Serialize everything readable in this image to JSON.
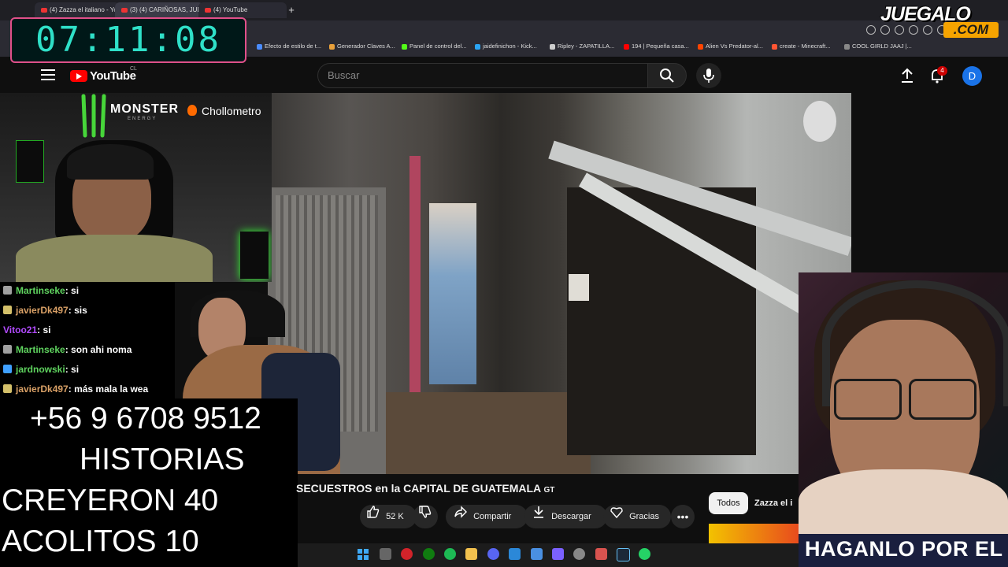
{
  "browser": {
    "tabs": [
      {
        "label": "(4) Zazza el italiano - YouT"
      },
      {
        "label": "(3) (4) CARIÑOSAS, JUD..."
      },
      {
        "label": "(4) YouTube"
      }
    ],
    "bookmarks": [
      {
        "label": "Efecto de estilo de t...",
        "color": "#4a8cff"
      },
      {
        "label": "Generador Claves A...",
        "color": "#e8a03a"
      },
      {
        "label": "Panel de control del...",
        "color": "#53fc18"
      },
      {
        "label": "jaidefinichon - Kick...",
        "color": "#2aa4f4"
      },
      {
        "label": "Ripley - ZAPATILLA...",
        "color": "#cccccc"
      },
      {
        "label": "194 | Pequeña casa...",
        "color": "#ff0000"
      },
      {
        "label": "Alien Vs Predator-al...",
        "color": "#ff4400"
      },
      {
        "label": "create - Minecraft...",
        "color": "#ff5533"
      },
      {
        "label": "COOL GIRLD JAAJ |...",
        "color": "#888888"
      }
    ]
  },
  "timer": {
    "value": "07:11:08"
  },
  "watermark": {
    "line1": "JUEGALO",
    "line2": ".COM"
  },
  "youtube": {
    "logo": "YouTube",
    "country": "CL",
    "search_placeholder": "Buscar",
    "notifications": "4",
    "avatar_letter": "D",
    "video_title": "SECUESTROS en la CAPITAL DE GUATEMALA",
    "video_title_suffix": "GT",
    "likes": "52 K",
    "share_label": "Compartir",
    "download_label": "Descargar",
    "thanks_label": "Gracias",
    "chips": {
      "all": "Todos",
      "channel": "Zazza el i"
    }
  },
  "sponsors": {
    "monster": "MONSTER",
    "monster_sub": "ENERGY",
    "chollo": "Chollometro"
  },
  "chat": [
    {
      "user": "Martinseke",
      "msg": ": si",
      "color": "#5fd35f",
      "badge": "#a0a0a0"
    },
    {
      "user": "javierDk497",
      "msg": ": sis",
      "color": "#d9a066",
      "badge": "#d4c06a"
    },
    {
      "user": "Vitoo21",
      "msg": ": si",
      "color": "#b24bff",
      "badge": ""
    },
    {
      "user": "Martinseke",
      "msg": ": son ahi noma",
      "color": "#5fd35f",
      "badge": "#a0a0a0"
    },
    {
      "user": "jardnowski",
      "msg": ": si",
      "color": "#5fd35f",
      "badge": "#3fa0ff"
    },
    {
      "user": "javierDk497",
      "msg": ": más mala la wea",
      "color": "#d9a066",
      "badge": "#d4c06a"
    }
  ],
  "overlay": {
    "phone": "+56 9 6708 9512",
    "line2": "HISTORIAS",
    "line3": "CREYERON 40",
    "line4": "ACOLITOS 10"
  },
  "facecam_banner": "HAGANLO POR EL"
}
